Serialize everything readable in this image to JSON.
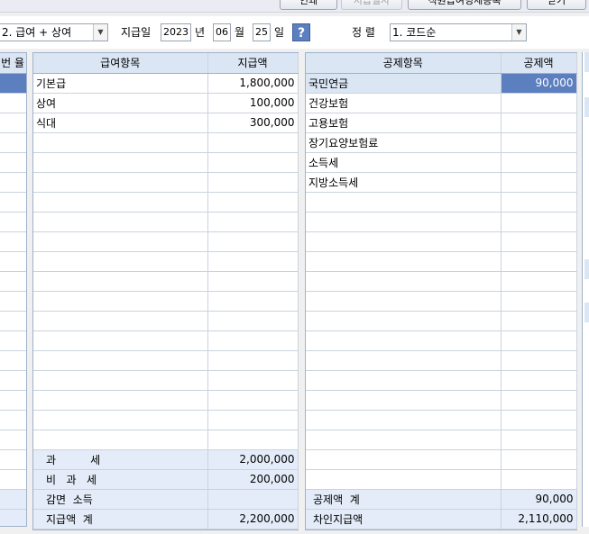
{
  "toolbar": {
    "buttons": [
      {
        "label": "인쇄",
        "disabled": false
      },
      {
        "label": "지급일자",
        "disabled": true
      },
      {
        "label": "직원급여명세등록",
        "disabled": false
      },
      {
        "label": "닫기",
        "disabled": false
      }
    ]
  },
  "filters": {
    "pay_type": "2. 급여 + 상여",
    "pay_date_label": "지급일",
    "year": "2023",
    "year_unit": "년",
    "month": "06",
    "month_unit": "월",
    "day": "25",
    "day_unit": "일",
    "help_label": "?",
    "sort_label": "정 렬",
    "sort_value": "1. 코드순"
  },
  "left_stub": {
    "header": "번 율"
  },
  "earnings": {
    "headers": [
      "급여항목",
      "지급액"
    ],
    "rows": [
      {
        "item": "기본급",
        "amount": "1,800,000"
      },
      {
        "item": "상여",
        "amount": "100,000"
      },
      {
        "item": "식대",
        "amount": "300,000"
      }
    ],
    "empty_rows": 16,
    "summary": [
      {
        "label": "과          세",
        "amount": "2,000,000"
      },
      {
        "label": "비   과   세",
        "amount": "200,000"
      },
      {
        "label": "감면  소득",
        "amount": ""
      },
      {
        "label": "지급액  계",
        "amount": "2,200,000"
      }
    ]
  },
  "deductions": {
    "headers": [
      "공제항목",
      "공제액"
    ],
    "rows": [
      {
        "item": "국민연금",
        "amount": "90,000"
      },
      {
        "item": "건강보험",
        "amount": ""
      },
      {
        "item": "고용보험",
        "amount": ""
      },
      {
        "item": "장기요양보험료",
        "amount": ""
      },
      {
        "item": "소득세",
        "amount": ""
      },
      {
        "item": "지방소득세",
        "amount": ""
      }
    ],
    "empty_rows": 15,
    "summary": [
      {
        "label": "공제액  계",
        "amount": "90,000"
      },
      {
        "label": "차인지급액",
        "amount": "2,110,000"
      }
    ]
  },
  "colors": {
    "header_bg": "#dbe6f4",
    "selection": "#5b7fbf",
    "summary_bg": "#e3ecf8"
  }
}
